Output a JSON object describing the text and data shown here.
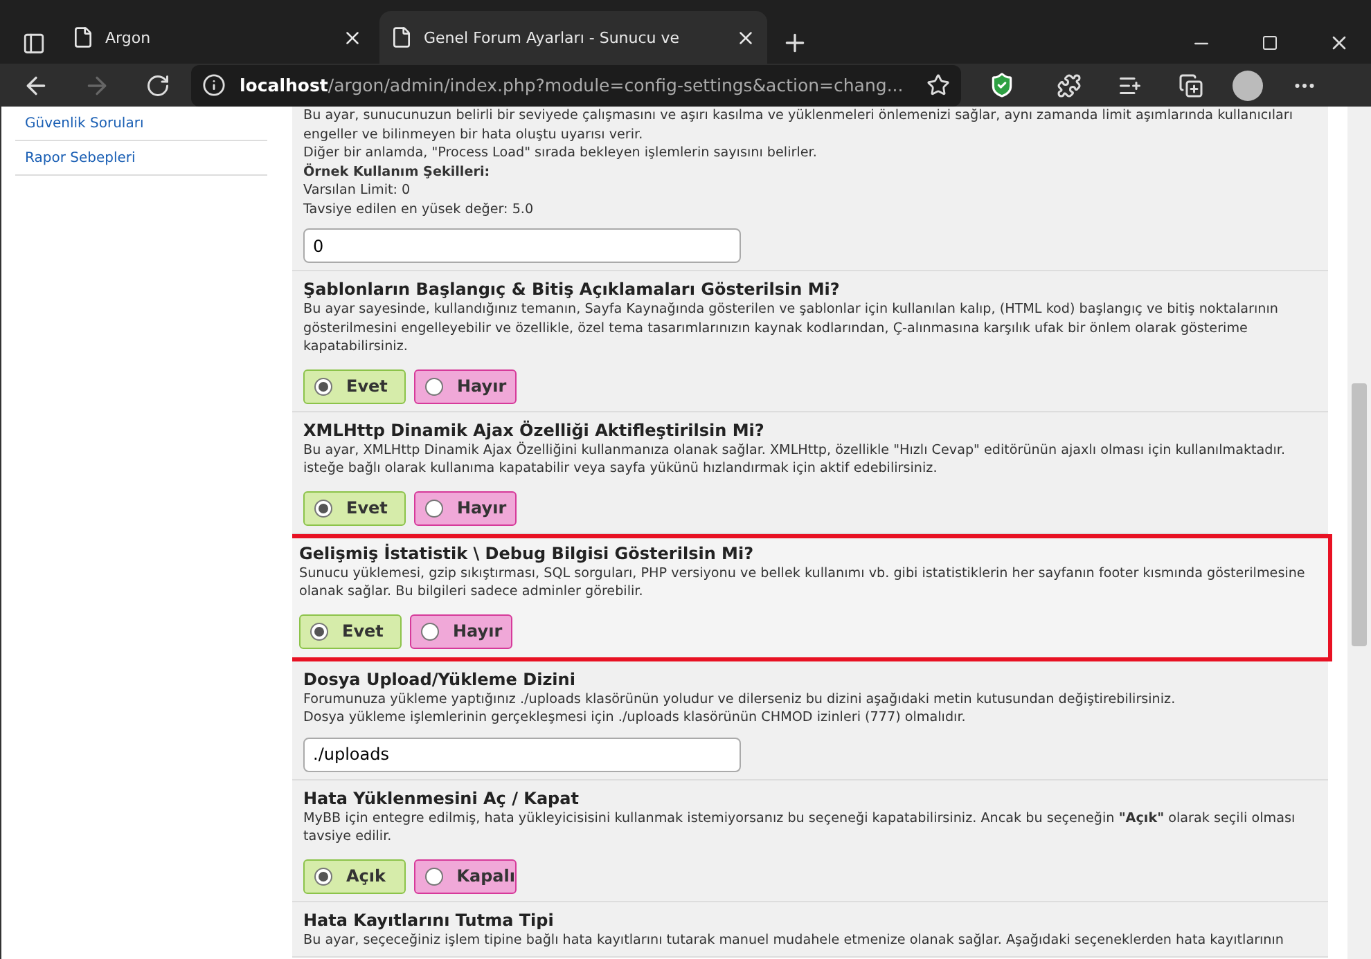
{
  "browser": {
    "tabs": [
      {
        "title": "Argon",
        "selected": false
      },
      {
        "title": "Genel Forum Ayarları - Sunucu ve",
        "selected": true
      }
    ],
    "address": {
      "host": "localhost",
      "path": "/argon/admin/index.php?module=config-settings&action=chang..."
    }
  },
  "sidebar": {
    "items": [
      "Güvenlik Soruları",
      "Rapor Sebepleri"
    ]
  },
  "sections": [
    {
      "kind": "text",
      "highlighted": false,
      "description": [
        {
          "text": "Bu ayar, sunucunuzun belirli bir seviyede çalışmasını ve aşırı kasılma ve yüklenmeleri önlemenizi sağlar, aynı zamanda limit aşımlarında kullanıcıları engeller ve bilinmeyen bir hata oluştu uyarısı verir.",
          "bold": false
        },
        {
          "text": "Diğer bir anlamda, \"Process Load\" sırada bekleyen işlemlerin sayısını belirler.",
          "bold": false
        },
        {
          "text": "Örnek Kullanım Şekilleri:",
          "bold": true
        },
        {
          "text": "Varsılan Limit: 0",
          "bold": false
        },
        {
          "text": "Tavsiye edilen en yüsek değer: 5.0",
          "bold": false
        }
      ],
      "value": "0"
    },
    {
      "kind": "radio",
      "highlighted": false,
      "title": "Şablonların Başlangıç & Bitiş Açıklamaları Gösterilsin Mi?",
      "description": [
        {
          "text": "Bu ayar sayesinde, kullandığınız temanın, Sayfa Kaynağında gösterilen ve şablonlar için kullanılan kalıp, (HTML kod) başlangıç ve bitiş noktalarının gösterilmesini engelleyebilir ve özellikle, özel tema tasarımlarınızın kaynak kodlarından, Ç-alınmasına karşılık ufak bir önlem olarak gösterime kapatabilirsiniz.",
          "bold": false
        }
      ],
      "options": [
        {
          "label": "Evet",
          "selected": true
        },
        {
          "label": "Hayır",
          "selected": false
        }
      ]
    },
    {
      "kind": "radio",
      "highlighted": false,
      "title": "XMLHttp Dinamik Ajax Özelliği Aktifleştirilsin Mi?",
      "description": [
        {
          "text": "Bu ayar, XMLHttp Dinamik Ajax Özelliğini kullanmanıza olanak sağlar. XMLHttp, özellikle \"Hızlı Cevap\" editörünün ajaxlı olması için kullanılmaktadır. isteğe bağlı olarak kullanıma kapatabilir veya sayfa yükünü hızlandırmak için aktif edebilirsiniz.",
          "bold": false
        }
      ],
      "options": [
        {
          "label": "Evet",
          "selected": true
        },
        {
          "label": "Hayır",
          "selected": false
        }
      ]
    },
    {
      "kind": "radio",
      "highlighted": true,
      "title": "Gelişmiş İstatistik \\ Debug Bilgisi Gösterilsin Mi?",
      "description": [
        {
          "text": "Sunucu yüklemesi, gzip sıkıştırması, SQL sorguları, PHP versiyonu ve bellek kullanımı vb. gibi istatistiklerin her sayfanın footer kısmında gösterilmesine olanak sağlar. Bu bilgileri sadece adminler görebilir.",
          "bold": false
        }
      ],
      "options": [
        {
          "label": "Evet",
          "selected": true
        },
        {
          "label": "Hayır",
          "selected": false
        }
      ]
    },
    {
      "kind": "text",
      "highlighted": false,
      "title": "Dosya Upload/Yükleme Dizini",
      "description": [
        {
          "text": "Forumunuza yükleme yaptığınız ./uploads klasörünün yoludur ve dilerseniz bu dizini aşağıdaki metin kutusundan değiştirebilirsiniz.",
          "bold": false
        },
        {
          "text": "Dosya yükleme işlemlerinin gerçekleşmesi için ./uploads klasörünün CHMOD izinleri (777) olmalıdır.",
          "bold": false
        }
      ],
      "value": "./uploads"
    },
    {
      "kind": "radio",
      "highlighted": false,
      "title": "Hata Yüklenmesini Aç / Kapat",
      "description": [
        {
          "text": "MyBB için entegre edilmiş, hata yükleyicisisini kullanmak istemiyorsanız bu seçeneği kapatabilirsiniz. Ancak bu seçeneğin **\"Açık\"** olarak seçili olması tavsiye edilir.",
          "bold": false
        }
      ],
      "options": [
        {
          "label": "Açık",
          "selected": true
        },
        {
          "label": "Kapalı",
          "selected": false
        }
      ]
    },
    {
      "kind": "info",
      "highlighted": false,
      "title": "Hata Kayıtlarını Tutma Tipi",
      "description": [
        {
          "text": "Bu ayar, seçeceğiniz işlem tipine bağlı hata kayıtlarını tutarak manuel mudahele etmenize olanak sağlar. Aşağıdaki seçeneklerden hata kayıtlarının",
          "bold": false
        }
      ]
    }
  ]
}
